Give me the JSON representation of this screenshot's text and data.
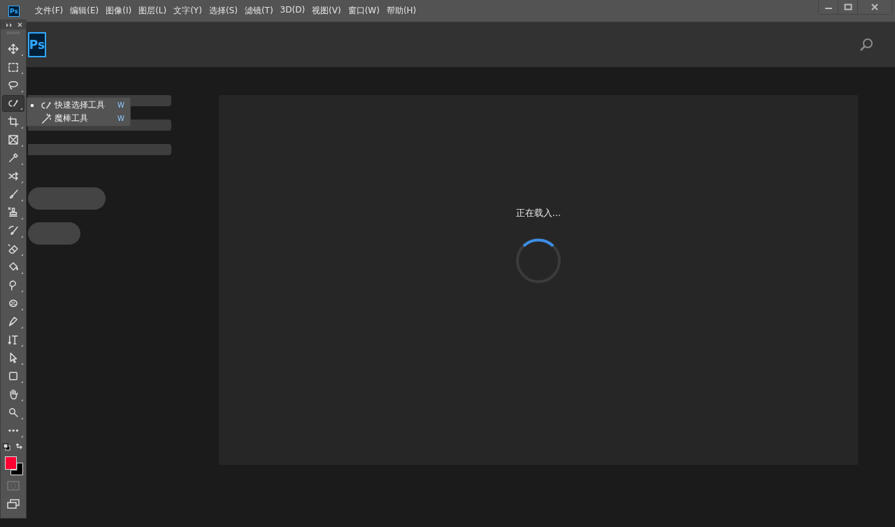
{
  "app_logo": "Ps",
  "menu": [
    "文件(F)",
    "编辑(E)",
    "图像(I)",
    "图层(L)",
    "文字(Y)",
    "选择(S)",
    "滤镜(T)",
    "3D(D)",
    "视图(V)",
    "窗口(W)",
    "帮助(H)"
  ],
  "home_logo": "Ps",
  "toolbar": {
    "tools": [
      {
        "kind": "move",
        "selected": false
      },
      {
        "kind": "marquee",
        "selected": false
      },
      {
        "kind": "lasso",
        "selected": false
      },
      {
        "kind": "quick-select",
        "selected": true
      },
      {
        "kind": "crop",
        "selected": false
      },
      {
        "kind": "frame",
        "selected": false
      },
      {
        "kind": "eyedropper",
        "selected": false
      },
      {
        "kind": "healing",
        "selected": false
      },
      {
        "kind": "brush",
        "selected": false
      },
      {
        "kind": "stamp",
        "selected": false
      },
      {
        "kind": "history-brush",
        "selected": false
      },
      {
        "kind": "eraser",
        "selected": false
      },
      {
        "kind": "bucket",
        "selected": false
      },
      {
        "kind": "smudge",
        "selected": false
      },
      {
        "kind": "sponge",
        "selected": false
      },
      {
        "kind": "pen",
        "selected": false
      },
      {
        "kind": "type",
        "selected": false
      },
      {
        "kind": "path-select",
        "selected": false
      },
      {
        "kind": "rectangle",
        "selected": false
      },
      {
        "kind": "hand",
        "selected": false
      },
      {
        "kind": "zoom",
        "selected": false
      },
      {
        "kind": "more",
        "selected": false
      }
    ],
    "swatches": [
      {
        "kind": "background",
        "color": "#000000"
      },
      {
        "kind": "foreground",
        "color": "#ff0033"
      }
    ]
  },
  "flyout": [
    {
      "label": "快速选择工具",
      "shortcut": "W",
      "selected": true,
      "kind": "quick-select"
    },
    {
      "label": "魔棒工具",
      "shortcut": "W",
      "selected": false,
      "kind": "magic-wand"
    }
  ],
  "loading": {
    "text": "正在载入..."
  }
}
